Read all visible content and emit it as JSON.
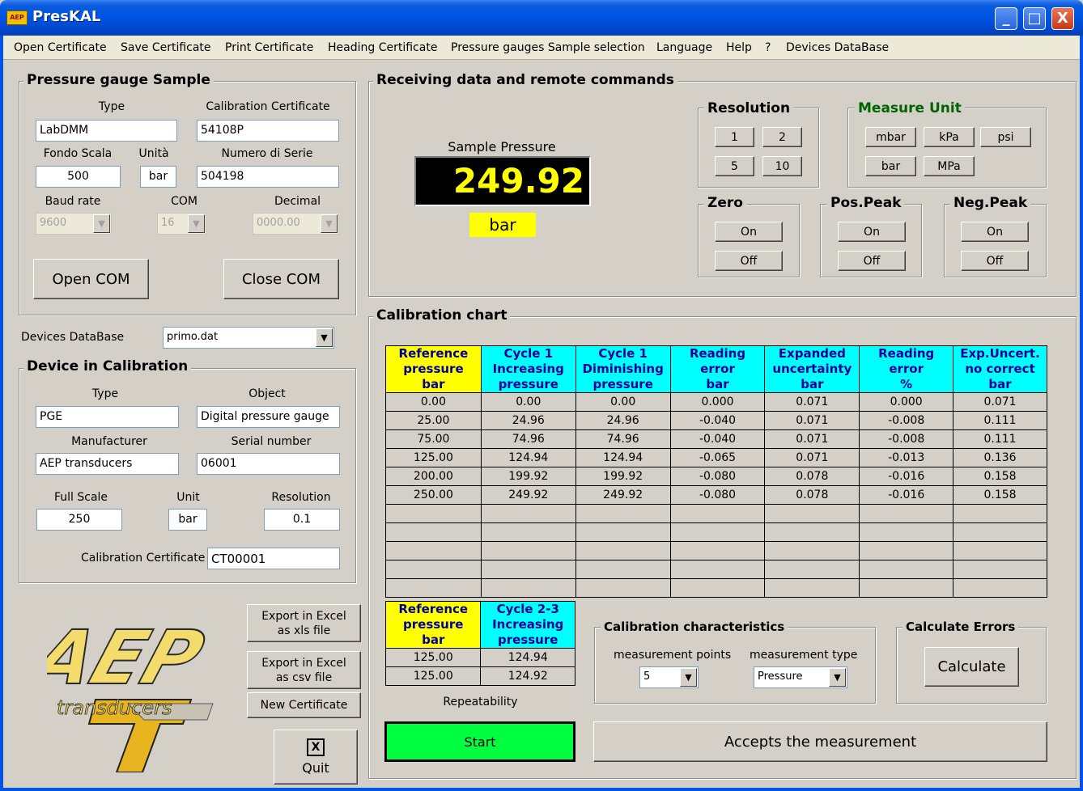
{
  "window": {
    "title": "PresKAL",
    "minimize": "_",
    "maximize": "□",
    "close": "X"
  },
  "menu": [
    "Open Certificate",
    "Save Certificate",
    "Print Certificate",
    "Heading Certificate",
    "Pressure gauges Sample selection",
    "Language",
    "Help",
    "?",
    "Devices DataBase"
  ],
  "sample": {
    "title": "Pressure gauge Sample",
    "type_label": "Type",
    "type": "LabDMM",
    "cert_label": "Calibration Certificate",
    "cert": "54108P",
    "fondo_label": "Fondo Scala",
    "fondo": "500",
    "unita_label": "Unità",
    "unita": "bar",
    "serie_label": "Numero di Serie",
    "serie": "504198",
    "baud_label": "Baud rate",
    "baud": "9600",
    "com_label": "COM",
    "com": "16",
    "decimal_label": "Decimal",
    "decimal": "0000.00",
    "open_com": "Open COM",
    "close_com": "Close COM"
  },
  "db": {
    "label": "Devices DataBase",
    "value": "primo.dat"
  },
  "device": {
    "title": "Device in Calibration",
    "type_label": "Type",
    "type": "PGE",
    "object_label": "Object",
    "object": "Digital pressure gauge",
    "manufacturer_label": "Manufacturer",
    "manufacturer": "AEP transducers",
    "serial_label": "Serial number",
    "serial": "06001",
    "fullscale_label": "Full Scale",
    "fullscale": "250",
    "unit_label": "Unit",
    "unit": "bar",
    "resolution_label": "Resolution",
    "resolution": "0.1",
    "cert_label": "Calibration Certificate",
    "cert": "CT00001"
  },
  "actions": {
    "export_xls_1": "Export in Excel",
    "export_xls_2": "as xls file",
    "export_csv_1": "Export in Excel",
    "export_csv_2": "as csv file",
    "new_cert": "New Certificate",
    "quit": "Quit",
    "quit_icon": "X"
  },
  "remote": {
    "title": "Receiving data and remote commands",
    "sample_pressure_label": "Sample Pressure",
    "sample_pressure": "249.92",
    "sample_unit": "bar",
    "resolution_title": "Resolution",
    "res_buttons": [
      "1",
      "2",
      "5",
      "10"
    ],
    "measure_unit_title": "Measure Unit",
    "unit_buttons": [
      "mbar",
      "kPa",
      "psi",
      "bar",
      "MPa"
    ],
    "zero_title": "Zero",
    "pospeak_title": "Pos.Peak",
    "negpeak_title": "Neg.Peak",
    "on": "On",
    "off": "Off"
  },
  "chart": {
    "title": "Calibration chart",
    "headers": [
      [
        "Reference",
        "pressure",
        "bar"
      ],
      [
        "Cycle 1",
        "Increasing",
        "pressure"
      ],
      [
        "Cycle 1",
        "Diminishing",
        "pressure"
      ],
      [
        "Reading",
        "error",
        "bar"
      ],
      [
        "Expanded",
        "uncertainty",
        "bar"
      ],
      [
        "Reading",
        "error",
        "%"
      ],
      [
        "Exp.Uncert.",
        "no correct",
        "bar"
      ]
    ],
    "rows": [
      [
        "0.00",
        "0.00",
        "0.00",
        "0.000",
        "0.071",
        "0.000",
        "0.071"
      ],
      [
        "25.00",
        "24.96",
        "24.96",
        "-0.040",
        "0.071",
        "-0.008",
        "0.111"
      ],
      [
        "75.00",
        "74.96",
        "74.96",
        "-0.040",
        "0.071",
        "-0.008",
        "0.111"
      ],
      [
        "125.00",
        "124.94",
        "124.94",
        "-0.065",
        "0.071",
        "-0.013",
        "0.136"
      ],
      [
        "200.00",
        "199.92",
        "199.92",
        "-0.080",
        "0.078",
        "-0.016",
        "0.158"
      ],
      [
        "250.00",
        "249.92",
        "249.92",
        "-0.080",
        "0.078",
        "-0.016",
        "0.158"
      ],
      [
        "",
        "",
        "",
        "",
        "",
        "",
        ""
      ],
      [
        "",
        "",
        "",
        "",
        "",
        "",
        ""
      ],
      [
        "",
        "",
        "",
        "",
        "",
        "",
        ""
      ],
      [
        "",
        "",
        "",
        "",
        "",
        "",
        ""
      ],
      [
        "",
        "",
        "",
        "",
        "",
        "",
        ""
      ]
    ]
  },
  "repeat": {
    "headers": [
      [
        "Reference",
        "pressure",
        "bar"
      ],
      [
        "Cycle 2-3",
        "Increasing",
        "pressure"
      ]
    ],
    "rows": [
      [
        "125.00",
        "124.94"
      ],
      [
        "125.00",
        "124.92"
      ]
    ],
    "label": "Repeatability"
  },
  "characteristics": {
    "title": "Calibration characteristics",
    "points_label": "measurement points",
    "points": "5",
    "type_label": "measurement type",
    "type": "Pressure"
  },
  "errors": {
    "title": "Calculate Errors",
    "calculate": "Calculate"
  },
  "bottom": {
    "start": "Start",
    "accept": "Accepts the measurement"
  },
  "logo": {
    "text_top": "AEP",
    "text_bottom": "transducers"
  },
  "colors": {
    "accent_yellow": "#ffff00",
    "accent_cyan": "#00ffff",
    "start_green": "#00ff40",
    "measure_unit_title": "#006400"
  }
}
